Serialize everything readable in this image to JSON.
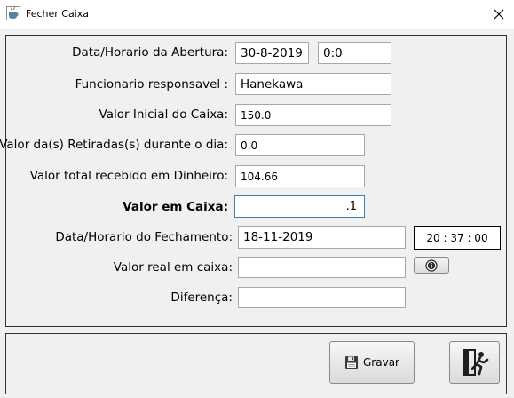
{
  "window": {
    "title": "Fecher Caixa",
    "app_icon": "java-cup-icon",
    "close_icon": "close-icon"
  },
  "form": {
    "abertura": {
      "label": "Data/Horario da Abertura:",
      "date": "30-8-2019",
      "time": "0:0"
    },
    "funcionario": {
      "label": "Funcionario responsavel :",
      "value": "Hanekawa"
    },
    "valor_inicial": {
      "label": "Valor Inicial do Caixa:",
      "value": "150.0"
    },
    "retiradas": {
      "label": "Valor da(s) Retiradas(s) durante o dia:",
      "value": "0.0"
    },
    "recebido": {
      "label": "Valor total recebido em Dinheiro:",
      "value": "104.66"
    },
    "em_caixa": {
      "label": "Valor em Caixa:",
      "value": ".1"
    },
    "fechamento": {
      "label": "Data/Horario do Fechamento:",
      "date": "18-11-2019",
      "time": "20 : 37 : 00"
    },
    "valor_real": {
      "label": "Valor real em caixa:",
      "value": "",
      "info_icon": "info-icon"
    },
    "diferenca": {
      "label": "Diferença:",
      "value": ""
    }
  },
  "actions": {
    "save_label": "Gravar",
    "save_icon": "floppy-disk-icon",
    "exit_icon": "exit-door-icon"
  },
  "colors": {
    "background": "#f0f0f0",
    "focus_border": "#3c7fb1",
    "field_border": "#a8a8a8"
  }
}
